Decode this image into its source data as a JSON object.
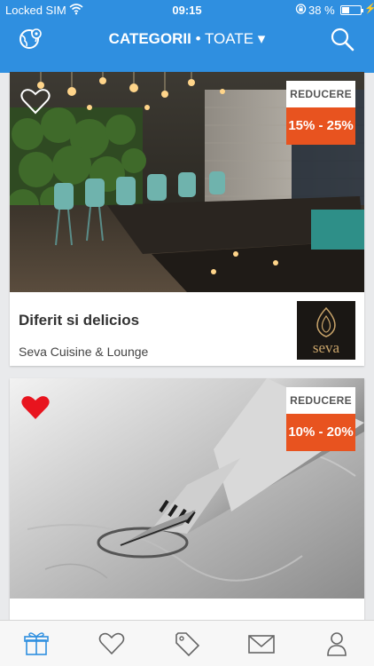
{
  "status": {
    "carrier": "Locked SIM",
    "time": "09:15",
    "battery": "38 %",
    "battery_level": 0.38
  },
  "header": {
    "title_bold": "CATEGORII",
    "title_rest": "• TOATE ▾"
  },
  "deals": [
    {
      "title": "Diferit si delicios",
      "venue": "Seva Cuisine & Lounge",
      "badge_label": "REDUCERE",
      "discount": "15% - 25%",
      "favorited": false,
      "logo_text": "seva"
    },
    {
      "title": "",
      "venue": "",
      "badge_label": "REDUCERE",
      "discount": "10% - 20%",
      "favorited": true
    }
  ],
  "tabbar": {
    "items": [
      "offers-icon",
      "heart-icon",
      "tag-icon",
      "envelope-icon",
      "person-icon"
    ],
    "active": 0
  },
  "colors": {
    "primary": "#2f8fe0",
    "discount": "#e8531f",
    "favorite": "#e8141e"
  }
}
